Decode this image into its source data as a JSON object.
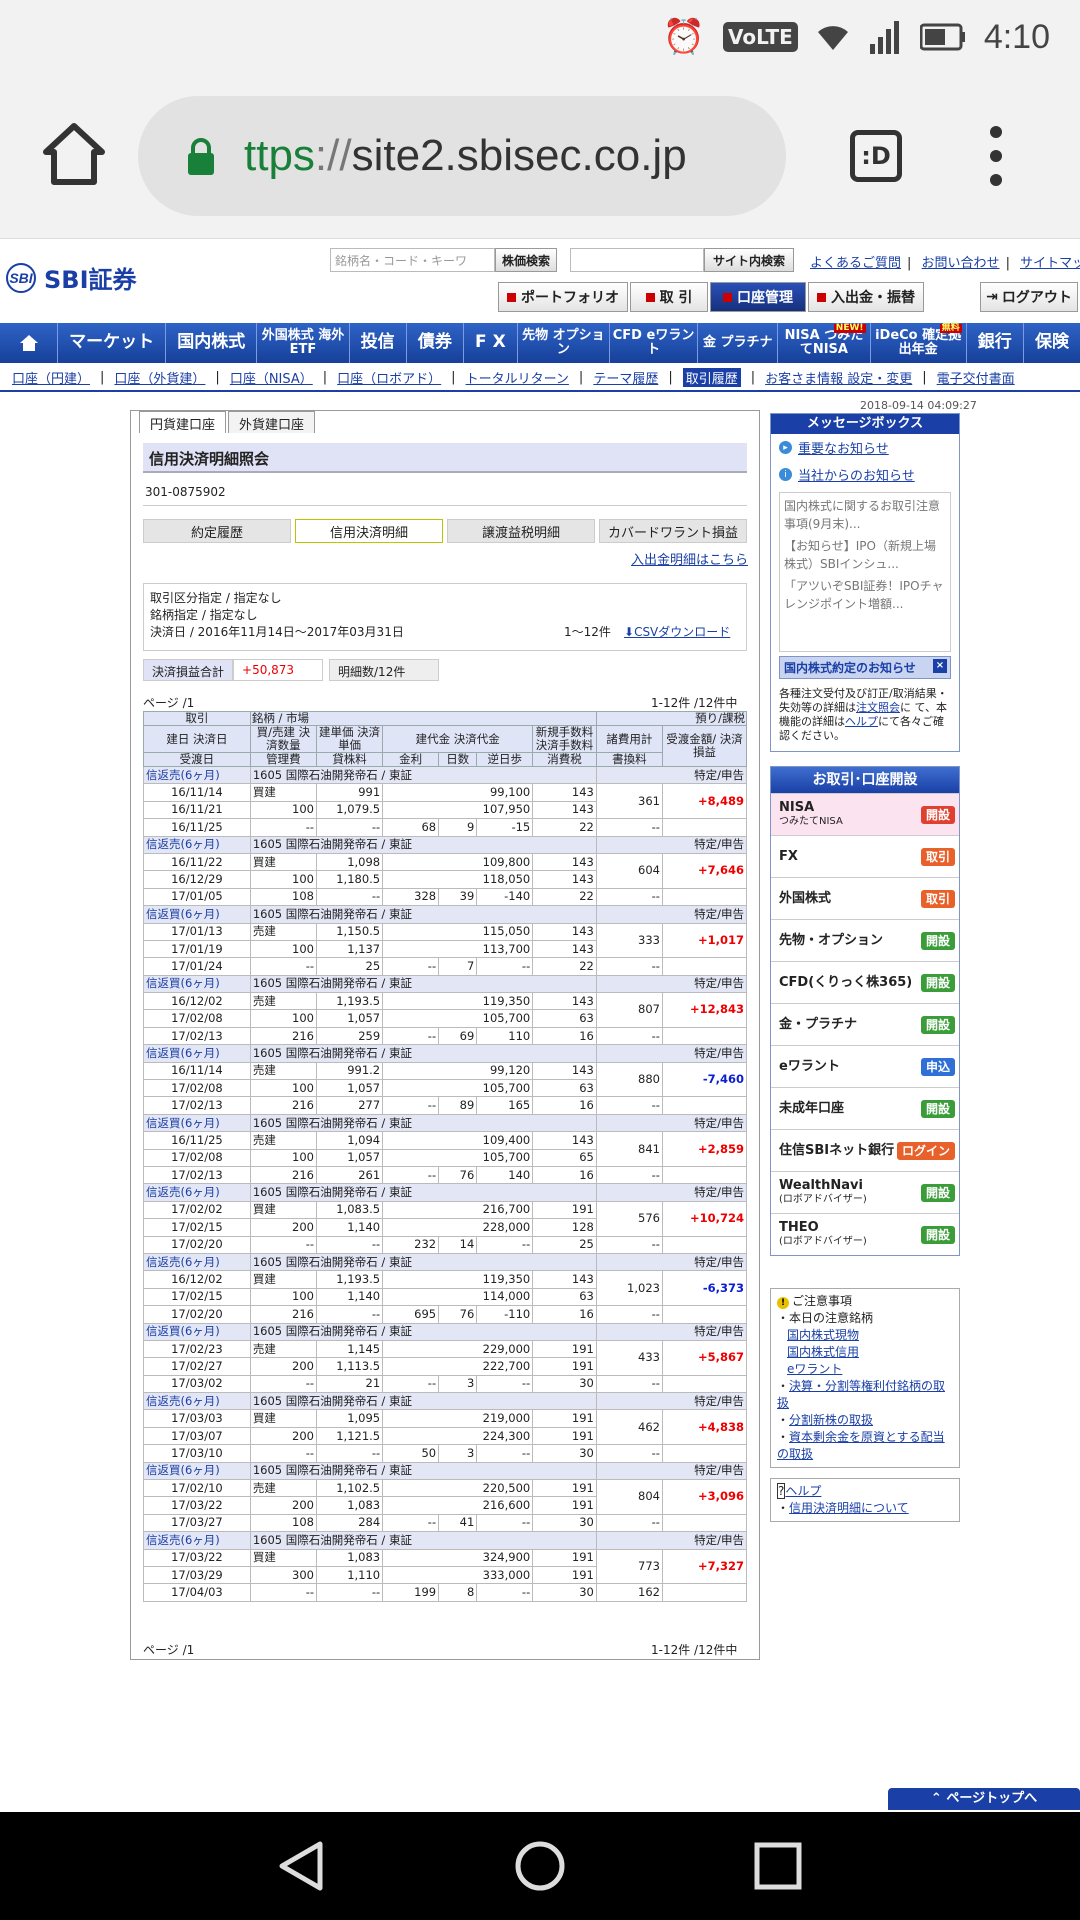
{
  "status": {
    "time": "4:10",
    "volte": "VoLTE"
  },
  "browser": {
    "url_s": "ttps",
    "url_sep": "://",
    "url_host": "site2.sbisec.co.jp",
    "tab_label": ":D"
  },
  "header": {
    "logo": "SBI証券",
    "logo_mark": "SBI",
    "search_placeholder": "銘柄名・コード・キーワ",
    "stock_search_btn": "株価検索",
    "site_search_btn": "サイト内検索",
    "links": [
      "よくあるご質問",
      "お問い合わせ",
      "サイトマップ"
    ],
    "tabs": [
      "ポートフォリオ",
      "取 引",
      "口座管理",
      "入出金・振替"
    ],
    "logout": "ログアウト"
  },
  "nav": [
    "マーケット",
    "国内株式",
    "外国株式 海外ETF",
    "投信",
    "債券",
    "F X",
    "先物 オプション",
    "CFD eワラント",
    "金 プラチナ",
    "NISA つみたてNISA",
    "iDeCo 確定拠出年金",
    "銀行",
    "保険"
  ],
  "nav_new": "NEW!",
  "nav_muryo": "無料",
  "subnav": [
    "口座（円建）",
    "口座（外貨建）",
    "口座（NISA）",
    "口座（ロボアド）",
    "トータルリターン",
    "テーマ履歴",
    "取引履歴",
    "お客さま情報 設定・変更",
    "電子交付書面"
  ],
  "datetime": "2018-09-14 04:09:27",
  "page": {
    "tabs": [
      "円貨建口座",
      "外貨建口座"
    ],
    "title": "信用決済明細照会",
    "account": "301-0875902",
    "segments": [
      "約定履歴",
      "信用決済明細",
      "譲渡益税明細",
      "カバードワラント損益"
    ],
    "cash_link": "入出金明細はこちら",
    "filter1": "取引区分指定 / 指定なし",
    "filter2": "銘柄指定 / 指定なし",
    "filter3": "決済日 / 2016年11月14日～2017年03月31日",
    "filter_count": "1〜12件",
    "csv": "CSVダウンロード",
    "summary_label": "決済損益合計",
    "summary_value": "+50,873",
    "summary_count": "明細数/12件",
    "page_label": "ページ /1",
    "count_label": "1-12件 /12件中"
  },
  "table": {
    "h1": [
      "取引",
      "銘柄 / 市場",
      "預り/課税"
    ],
    "h2": [
      "建日 決済日",
      "買/売建 決済数量",
      "建単価 決済単価",
      "建代金 決済代金",
      "新規手数料 決済手数料",
      "諸費用計",
      "受渡金額/ 決済損益"
    ],
    "h3": [
      "受渡日",
      "管理費",
      "貸株料",
      "金利",
      "日数",
      "逆日歩",
      "消費税",
      "書換料"
    ],
    "rows": [
      {
        "type": "信返売(6ヶ月)",
        "name": "1605 国際石油開発帝石 / 東証",
        "tax": "特定/申告",
        "d1": "16/11/14",
        "side": "買建",
        "p1": "991",
        "v1": "99,100",
        "f1": "143",
        "cost": "361",
        "d2": "16/11/21",
        "qty": "100",
        "p2": "1,079.5",
        "v2": "107,950",
        "f2": "143",
        "pl": "+8,489",
        "d3": "16/11/25",
        "mg": "--",
        "ln": "--",
        "int": "68",
        "days": "9",
        "gyk": "-15",
        "tax2": "22",
        "kk": "--"
      },
      {
        "type": "信返売(6ヶ月)",
        "name": "1605 国際石油開発帝石 / 東証",
        "tax": "特定/申告",
        "d1": "16/11/22",
        "side": "買建",
        "p1": "1,098",
        "v1": "109,800",
        "f1": "143",
        "cost": "604",
        "d2": "16/12/29",
        "qty": "100",
        "p2": "1,180.5",
        "v2": "118,050",
        "f2": "143",
        "pl": "+7,646",
        "d3": "17/01/05",
        "mg": "108",
        "ln": "--",
        "int": "328",
        "days": "39",
        "gyk": "-140",
        "tax2": "22",
        "kk": "--"
      },
      {
        "type": "信返買(6ヶ月)",
        "name": "1605 国際石油開発帝石 / 東証",
        "tax": "特定/申告",
        "d1": "17/01/13",
        "side": "売建",
        "p1": "1,150.5",
        "v1": "115,050",
        "f1": "143",
        "cost": "333",
        "d2": "17/01/19",
        "qty": "100",
        "p2": "1,137",
        "v2": "113,700",
        "f2": "143",
        "pl": "+1,017",
        "d3": "17/01/24",
        "mg": "--",
        "ln": "25",
        "int": "--",
        "days": "7",
        "gyk": "--",
        "tax2": "22",
        "kk": "--"
      },
      {
        "type": "信返買(6ヶ月)",
        "name": "1605 国際石油開発帝石 / 東証",
        "tax": "特定/申告",
        "d1": "16/12/02",
        "side": "売建",
        "p1": "1,193.5",
        "v1": "119,350",
        "f1": "143",
        "cost": "807",
        "d2": "17/02/08",
        "qty": "100",
        "p2": "1,057",
        "v2": "105,700",
        "f2": "63",
        "pl": "+12,843",
        "d3": "17/02/13",
        "mg": "216",
        "ln": "259",
        "int": "--",
        "days": "69",
        "gyk": "110",
        "tax2": "16",
        "kk": "--"
      },
      {
        "type": "信返買(6ヶ月)",
        "name": "1605 国際石油開発帝石 / 東証",
        "tax": "特定/申告",
        "d1": "16/11/14",
        "side": "売建",
        "p1": "991.2",
        "v1": "99,120",
        "f1": "143",
        "cost": "880",
        "d2": "17/02/08",
        "qty": "100",
        "p2": "1,057",
        "v2": "105,700",
        "f2": "63",
        "pl": "-7,460",
        "d3": "17/02/13",
        "mg": "216",
        "ln": "277",
        "int": "--",
        "days": "89",
        "gyk": "165",
        "tax2": "16",
        "kk": "--"
      },
      {
        "type": "信返買(6ヶ月)",
        "name": "1605 国際石油開発帝石 / 東証",
        "tax": "特定/申告",
        "d1": "16/11/25",
        "side": "売建",
        "p1": "1,094",
        "v1": "109,400",
        "f1": "143",
        "cost": "841",
        "d2": "17/02/08",
        "qty": "100",
        "p2": "1,057",
        "v2": "105,700",
        "f2": "65",
        "pl": "+2,859",
        "d3": "17/02/13",
        "mg": "216",
        "ln": "261",
        "int": "--",
        "days": "76",
        "gyk": "140",
        "tax2": "16",
        "kk": "--"
      },
      {
        "type": "信返売(6ヶ月)",
        "name": "1605 国際石油開発帝石 / 東証",
        "tax": "特定/申告",
        "d1": "17/02/02",
        "side": "買建",
        "p1": "1,083.5",
        "v1": "216,700",
        "f1": "191",
        "cost": "576",
        "d2": "17/02/15",
        "qty": "200",
        "p2": "1,140",
        "v2": "228,000",
        "f2": "128",
        "pl": "+10,724",
        "d3": "17/02/20",
        "mg": "--",
        "ln": "--",
        "int": "232",
        "days": "14",
        "gyk": "--",
        "tax2": "25",
        "kk": "--"
      },
      {
        "type": "信返売(6ヶ月)",
        "name": "1605 国際石油開発帝石 / 東証",
        "tax": "特定/申告",
        "d1": "16/12/02",
        "side": "買建",
        "p1": "1,193.5",
        "v1": "119,350",
        "f1": "143",
        "cost": "1,023",
        "d2": "17/02/15",
        "qty": "100",
        "p2": "1,140",
        "v2": "114,000",
        "f2": "63",
        "pl": "-6,373",
        "d3": "17/02/20",
        "mg": "216",
        "ln": "--",
        "int": "695",
        "days": "76",
        "gyk": "-110",
        "tax2": "16",
        "kk": "--"
      },
      {
        "type": "信返買(6ヶ月)",
        "name": "1605 国際石油開発帝石 / 東証",
        "tax": "特定/申告",
        "d1": "17/02/23",
        "side": "売建",
        "p1": "1,145",
        "v1": "229,000",
        "f1": "191",
        "cost": "433",
        "d2": "17/02/27",
        "qty": "200",
        "p2": "1,113.5",
        "v2": "222,700",
        "f2": "191",
        "pl": "+5,867",
        "d3": "17/03/02",
        "mg": "--",
        "ln": "21",
        "int": "--",
        "days": "3",
        "gyk": "--",
        "tax2": "30",
        "kk": "--"
      },
      {
        "type": "信返売(6ヶ月)",
        "name": "1605 国際石油開発帝石 / 東証",
        "tax": "特定/申告",
        "d1": "17/03/03",
        "side": "買建",
        "p1": "1,095",
        "v1": "219,000",
        "f1": "191",
        "cost": "462",
        "d2": "17/03/07",
        "qty": "200",
        "p2": "1,121.5",
        "v2": "224,300",
        "f2": "191",
        "pl": "+4,838",
        "d3": "17/03/10",
        "mg": "--",
        "ln": "--",
        "int": "50",
        "days": "3",
        "gyk": "--",
        "tax2": "30",
        "kk": "--"
      },
      {
        "type": "信返買(6ヶ月)",
        "name": "1605 国際石油開発帝石 / 東証",
        "tax": "特定/申告",
        "d1": "17/02/10",
        "side": "売建",
        "p1": "1,102.5",
        "v1": "220,500",
        "f1": "191",
        "cost": "804",
        "d2": "17/03/22",
        "qty": "200",
        "p2": "1,083",
        "v2": "216,600",
        "f2": "191",
        "pl": "+3,096",
        "d3": "17/03/27",
        "mg": "108",
        "ln": "284",
        "int": "--",
        "days": "41",
        "gyk": "--",
        "tax2": "30",
        "kk": "--"
      },
      {
        "type": "信返売(6ヶ月)",
        "name": "1605 国際石油開発帝石 / 東証",
        "tax": "特定/申告",
        "d1": "17/03/22",
        "side": "買建",
        "p1": "1,083",
        "v1": "324,900",
        "f1": "191",
        "cost": "773",
        "d2": "17/03/29",
        "qty": "300",
        "p2": "1,110",
        "v2": "333,000",
        "f2": "191",
        "pl": "+7,327",
        "d3": "17/04/03",
        "mg": "--",
        "ln": "--",
        "int": "199",
        "days": "8",
        "gyk": "--",
        "tax2": "30",
        "kk": "162"
      }
    ]
  },
  "sidebar": {
    "msg_title": "メッセージボックス",
    "msg_links": [
      "重要なお知らせ",
      "当社からのお知らせ"
    ],
    "news": [
      "国内株式に関するお取引注意事項(9月末)...",
      "【お知らせ】IPO（新規上場株式）SBIインシュ...",
      "「アツいぞSBI証券！IPOチャレンジポイント増額..."
    ],
    "kabu_title": "国内株式約定のお知らせ",
    "kabu_x": "×",
    "kabu_note1": "各種注文受付及び訂正/取消結果・失効等の詳細は",
    "kabu_link1": "注文照会",
    "kabu_note2": "に て、本機能の詳細は",
    "kabu_link2": "ヘルプ",
    "kabu_note3": "にて各々ご確認ください。",
    "trade_title": "お取引･口座開設",
    "trade": [
      {
        "label": "NISA",
        "sub": "つみたてNISA",
        "btn": "開設",
        "color": "red"
      },
      {
        "label": "FX",
        "sub": "",
        "btn": "取引",
        "color": "or"
      },
      {
        "label": "外国株式",
        "sub": "",
        "btn": "取引",
        "color": "or"
      },
      {
        "label": "先物・オプション",
        "sub": "",
        "btn": "開設",
        "color": "gr"
      },
      {
        "label": "CFD(くりっく株365)",
        "sub": "",
        "btn": "開設",
        "color": "gr"
      },
      {
        "label": "金・プラチナ",
        "sub": "",
        "btn": "開設",
        "color": "gr"
      },
      {
        "label": "eワラント",
        "sub": "",
        "btn": "申込",
        "color": "bl"
      },
      {
        "label": "未成年口座",
        "sub": "",
        "btn": "開設",
        "color": "gr"
      },
      {
        "label": "住信SBIネット銀行",
        "sub": "",
        "btn": "ログイン",
        "color": "or"
      },
      {
        "label": "WealthNavi",
        "sub": "(ロボアドバイザー)",
        "btn": "開設",
        "color": "gr"
      },
      {
        "label": "THEO",
        "sub": "(ロボアドバイザー)",
        "btn": "開設",
        "color": "gr"
      }
    ],
    "notes_title": "ご注意事項",
    "notes_today": "本日の注意銘柄",
    "notes_links": [
      "国内株式現物",
      "国内株式信用",
      "eワラント"
    ],
    "notes_items": [
      "決算・分割等権利付銘柄の取扱",
      "分割新株の取扱",
      "資本剰余金を原資とする配当の取扱"
    ],
    "help": "ヘルプ",
    "help_item": "信用決済明細について"
  },
  "pagetop": "ページトップへ"
}
